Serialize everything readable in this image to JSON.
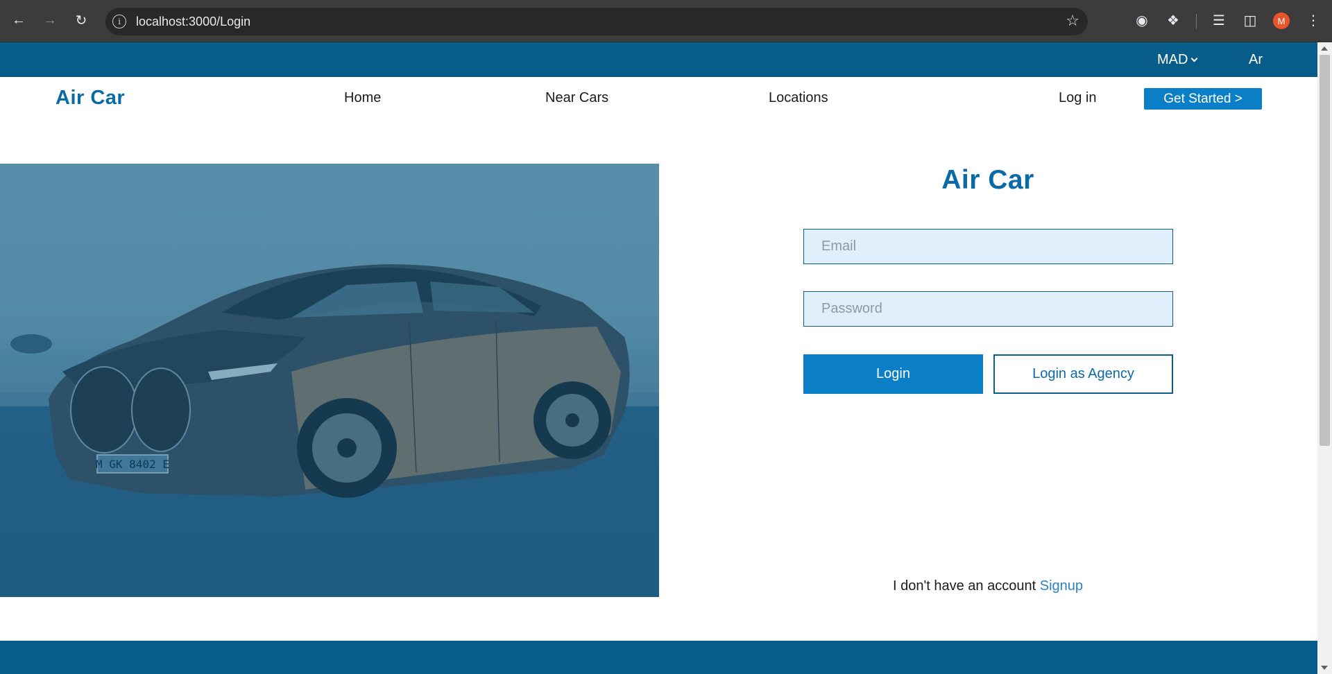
{
  "browser": {
    "url": "localhost:3000/Login",
    "profile_initial": "M",
    "icons": [
      "back-icon",
      "forward-icon",
      "reload-icon",
      "site-info-icon",
      "bookmark-star-icon",
      "extension-icon",
      "puzzle-icon",
      "media-icon",
      "side-panel-icon",
      "menu-icon"
    ]
  },
  "topbar": {
    "currency": "MAD",
    "language": "Ar"
  },
  "navbar": {
    "brand": "Air Car",
    "links": [
      "Home",
      "Near Cars",
      "Locations"
    ],
    "login": "Log in",
    "get_started": "Get Started >"
  },
  "hero": {
    "license_plate": "M GK 8402 E"
  },
  "login": {
    "title": "Air Car",
    "email_placeholder": "Email",
    "password_placeholder": "Password",
    "login_button": "Login",
    "agency_button": "Login as Agency",
    "no_account_text": "I don't have an account",
    "signup_link": "Signup"
  },
  "colors": {
    "primary_dark": "#085c8a",
    "primary": "#0a7fc8",
    "brand_text": "#0a6aa6",
    "input_bg": "#dff0fc"
  }
}
